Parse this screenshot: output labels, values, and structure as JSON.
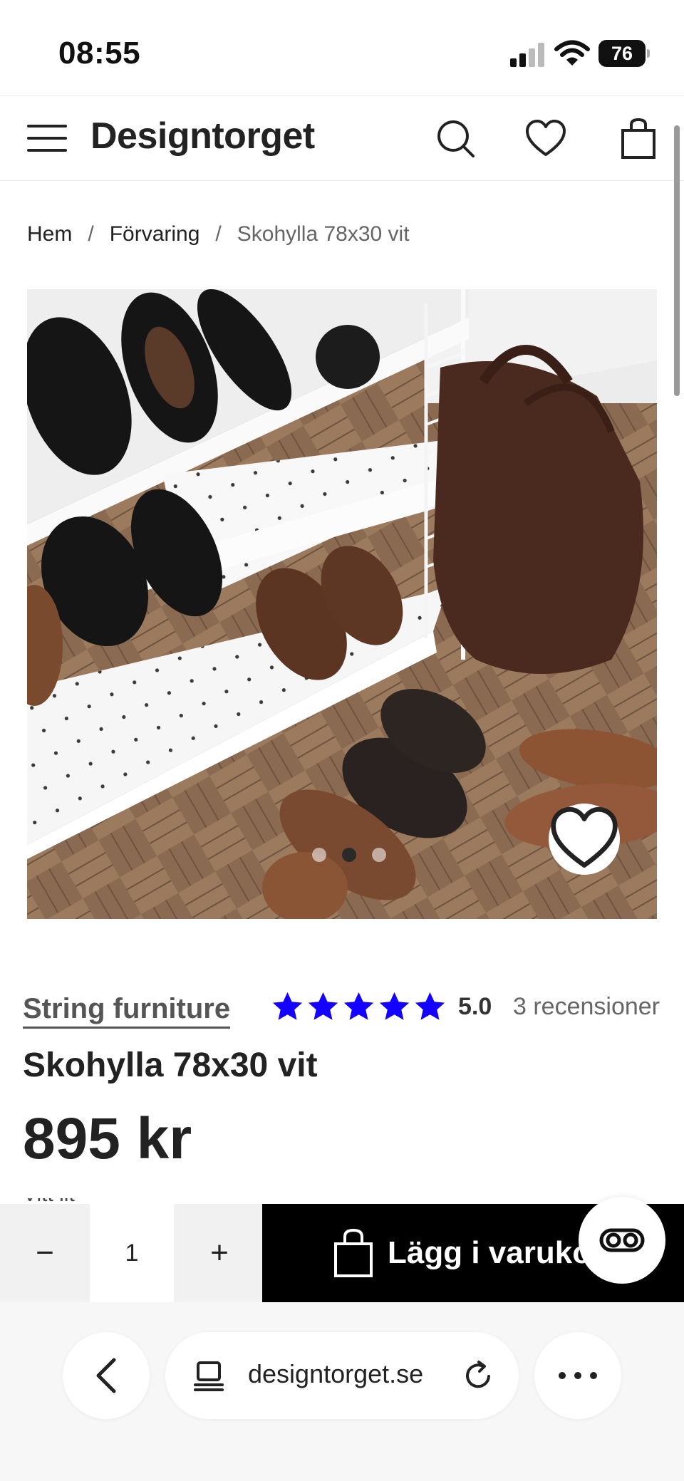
{
  "status_bar": {
    "time": "08:55",
    "battery": "76"
  },
  "header": {
    "brand": "Designtorget"
  },
  "breadcrumb": [
    {
      "label": "Hem"
    },
    {
      "label": "Förvaring"
    },
    {
      "label": "Skohylla 78x30 vit"
    }
  ],
  "breadcrumb_separator": "/",
  "gallery": {
    "slide_count": 3,
    "active_slide": 2
  },
  "product": {
    "brand": "String furniture",
    "rating_stars": 5,
    "rating_value": "5.0",
    "reviews": "3 recensioner",
    "title": "Skohylla 78x30 vit",
    "price": "895 kr",
    "partial_text": "Vitt lit"
  },
  "cart": {
    "minus": "−",
    "quantity": "1",
    "plus": "+",
    "add_label": "Lägg i varukorgen"
  },
  "browser": {
    "url": "designtorget.se"
  },
  "colors": {
    "star": "#1400ff",
    "cart_button": "#000000"
  }
}
